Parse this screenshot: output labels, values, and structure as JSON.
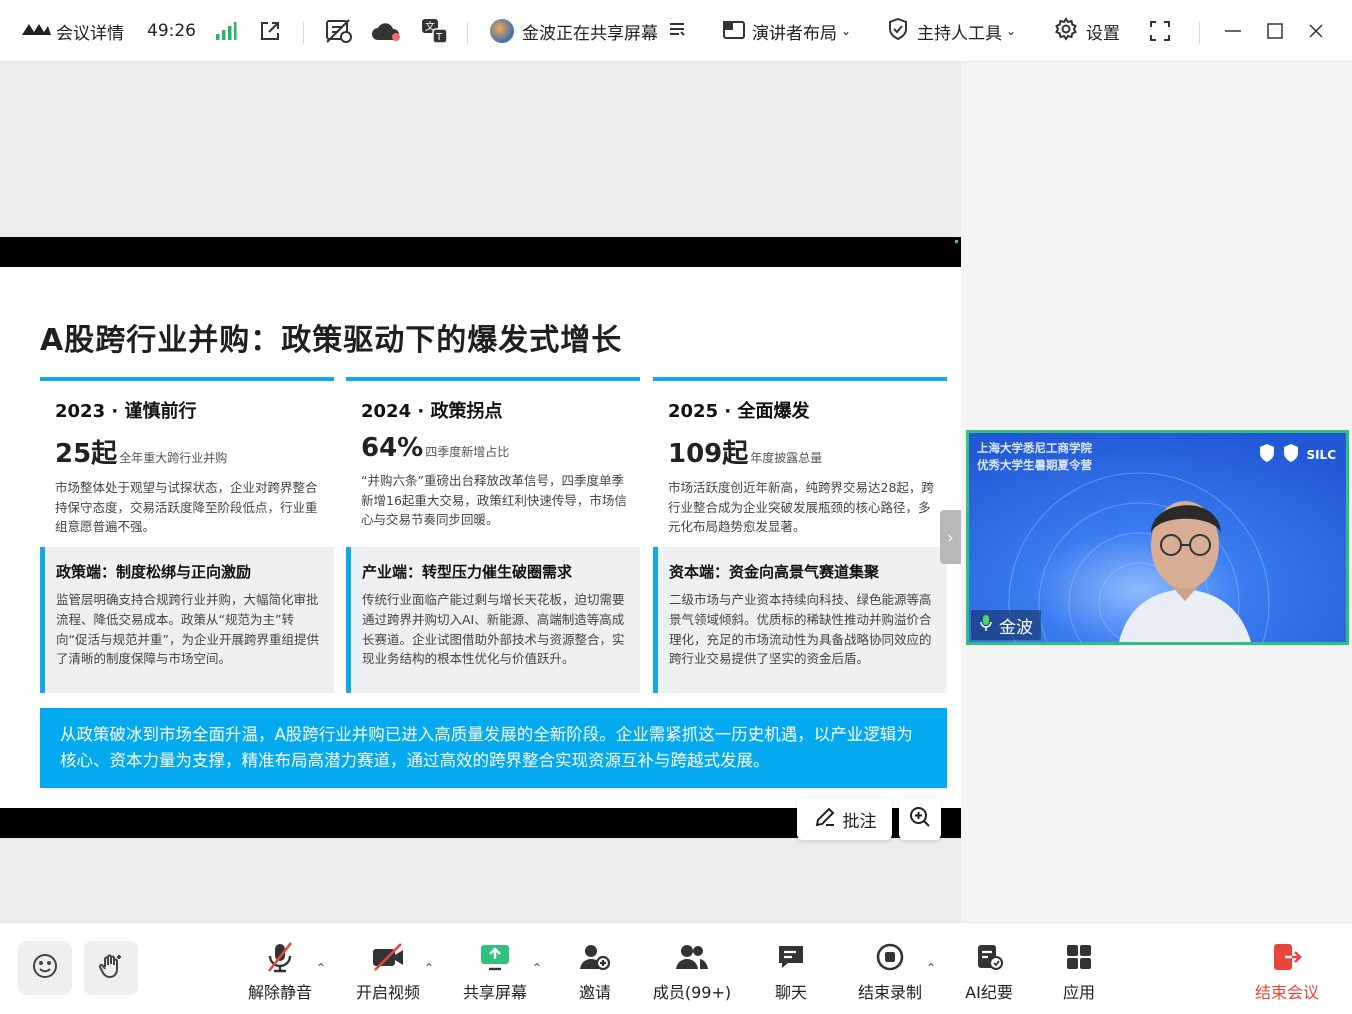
{
  "topbar": {
    "meeting_details_label": "会议详情",
    "timer": "49:26",
    "sharing_status": "金波正在共享屏幕",
    "layout_label": "演讲者布局",
    "host_tools_label": "主持人工具",
    "settings_label": "设置"
  },
  "slide": {
    "title": "A股跨行业并购：政策驱动下的爆发式增长",
    "columns": [
      {
        "heading": "2023 · 谨慎前行",
        "stat_value": "25起",
        "stat_caption": "全年重大跨行业并购",
        "description": "市场整体处于观望与试探状态，企业对跨界整合持保守态度，交易活跃度降至阶段低点，行业重组意愿普遍不强。"
      },
      {
        "heading": "2024 · 政策拐点",
        "stat_value": "64%",
        "stat_caption": "四季度新增占比",
        "description": "“并购六条”重磅出台释放改革信号，四季度单季新增16起重大交易，政策红利快速传导，市场信心与交易节奏同步回暖。"
      },
      {
        "heading": "2025 · 全面爆发",
        "stat_value": "109起",
        "stat_caption": "年度披露总量",
        "description": "市场活跃度创近年新高，纯跨界交易达28起，跨行业整合成为企业突破发展瓶颈的核心路径，多元化布局趋势愈发显著。"
      }
    ],
    "cards": [
      {
        "title": "政策端：制度松绑与正向激励",
        "body": "监管层明确支持合规跨行业并购，大幅简化审批流程、降低交易成本。政策从“规范为主”转向“促活与规范并重”，为企业开展跨界重组提供了清晰的制度保障与市场空间。"
      },
      {
        "title": "产业端：转型压力催生破圈需求",
        "body": "传统行业面临产能过剩与增长天花板，迫切需要通过跨界并购切入AI、新能源、高端制造等高成长赛道。企业试图借助外部技术与资源整合，实现业务结构的根本性优化与价值跃升。"
      },
      {
        "title": "资本端：资金向高景气赛道集聚",
        "body": "二级市场与产业资本持续向科技、绿色能源等高景气领域倾斜。优质标的稀缺性推动并购溢价合理化，充足的市场流动性为具备战略协同效应的跨行业交易提供了坚实的资金后盾。"
      }
    ],
    "summary": "从政策破冰到市场全面升温，A股跨行业并购已进入高质量发展的全新阶段。企业需紧抓这一历史机遇，以产业逻辑为核心、资本力量为支撑，精准布局高潜力赛道，通过高效的跨界整合实现资源互补与跨越式发展。"
  },
  "stage_controls": {
    "annotate_label": "批注"
  },
  "video": {
    "banner_line1": "上海大学悉尼工商学院",
    "banner_line2": "优秀大学生暑期夏令营",
    "logo_text": "SILC",
    "participant_name": "金波"
  },
  "toolbar": {
    "unmute_label": "解除静音",
    "start_video_label": "开启视频",
    "share_screen_label": "共享屏幕",
    "invite_label": "邀请",
    "members_label": "成员(99+)",
    "chat_label": "聊天",
    "stop_recording_label": "结束录制",
    "ai_minutes_label": "AI纪要",
    "apps_label": "应用",
    "end_meeting_label": "结束会议"
  },
  "colors": {
    "accent_blue": "#13a9e8",
    "summary_blue": "#04aaef",
    "active_green": "#2ec27e",
    "end_red": "#e8463a",
    "signal_green": "#27b36a"
  }
}
